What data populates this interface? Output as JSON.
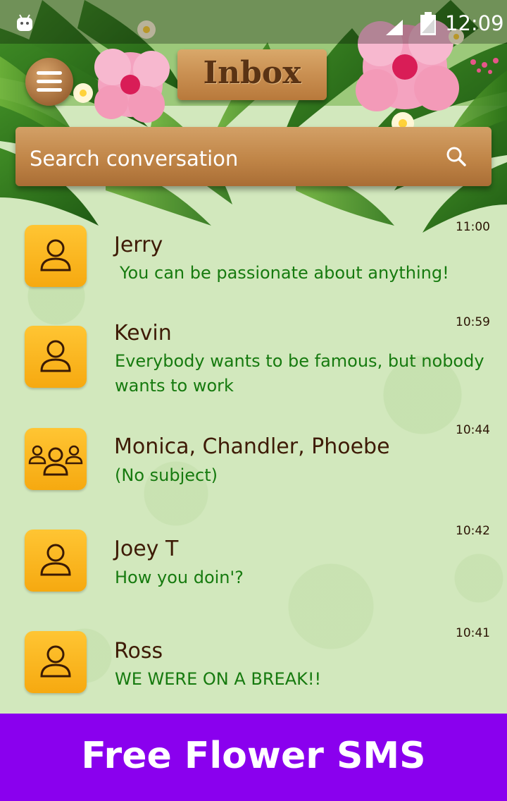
{
  "status_bar": {
    "time": "12:09",
    "left_icon": "android-icon",
    "right_icons": [
      "signal-icon",
      "battery-icon"
    ]
  },
  "header": {
    "title": "Inbox",
    "menu_icon": "hamburger-menu-icon",
    "search": {
      "placeholder": "Search conversation",
      "icon": "search-icon"
    }
  },
  "conversations": [
    {
      "name": "Jerry",
      "snippet": "You can be passionate about anything!",
      "time": "11:00",
      "avatar": "person-icon"
    },
    {
      "name": "Kevin",
      "snippet": "Everybody wants to be famous, but nobody wants to work",
      "time": "10:59",
      "avatar": "person-icon"
    },
    {
      "name": "Monica, Chandler, Phoebe",
      "snippet": "(No subject)",
      "time": "10:44",
      "avatar": "group-icon"
    },
    {
      "name": "Joey T",
      "snippet": "How you doin'?",
      "time": "10:42",
      "avatar": "person-icon"
    },
    {
      "name": "Ross",
      "snippet": "WE WERE ON A BREAK!!",
      "time": "10:41",
      "avatar": "person-icon"
    }
  ],
  "footer": {
    "banner_text": "Free Flower SMS"
  },
  "colors": {
    "background": "#d2e8bd",
    "name_text": "#3e1b06",
    "snippet_text": "#167a0f",
    "avatar_bg": "#ffc533",
    "wood": "#c98f51",
    "footer_bg": "#8a00ee"
  }
}
